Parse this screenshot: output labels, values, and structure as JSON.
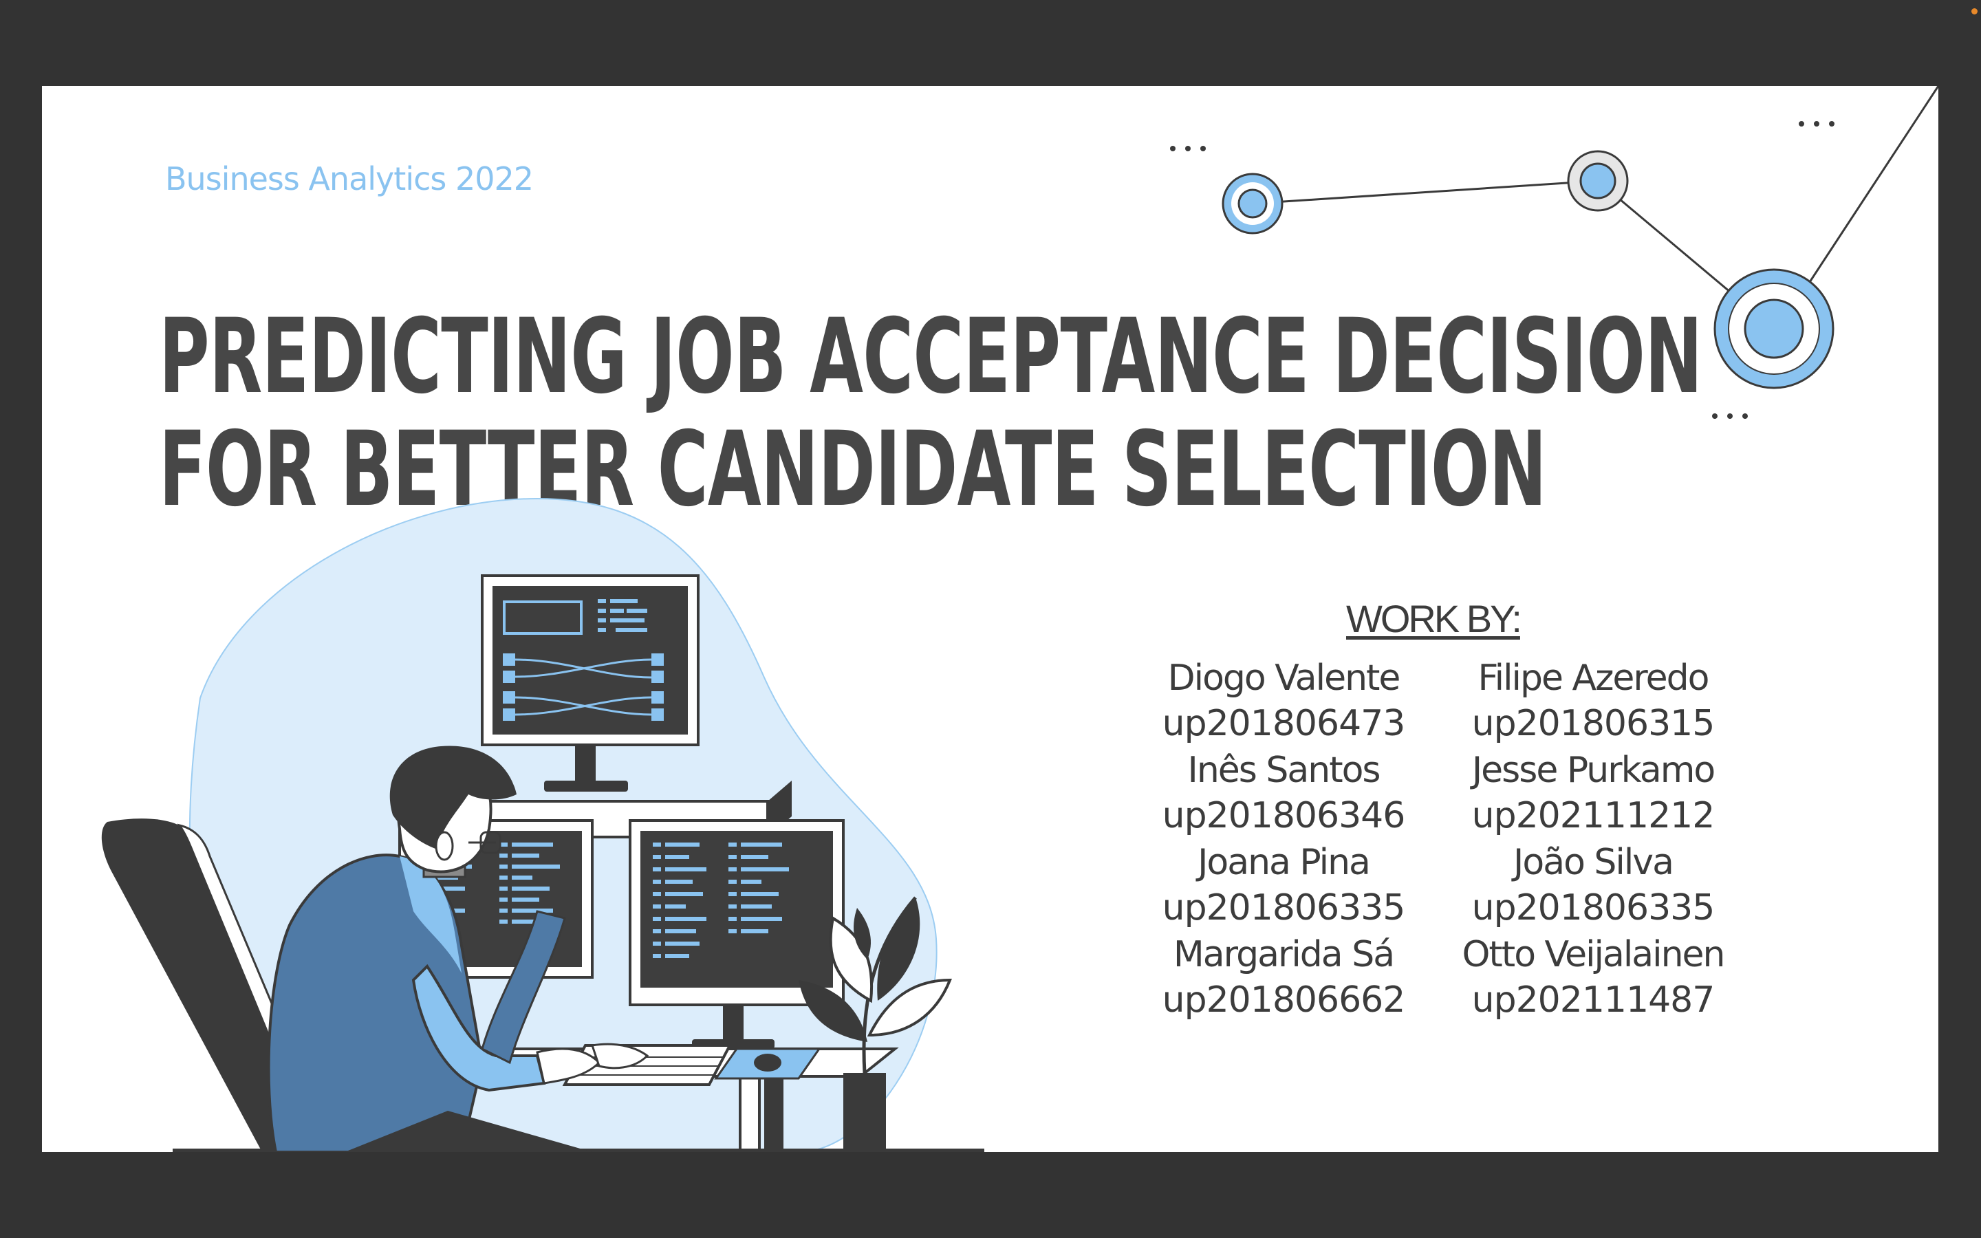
{
  "slide": {
    "subtitle": "Business Analytics 2022",
    "title_line1": "PREDICTING JOB ACCEPTANCE DECISION",
    "title_line2": "FOR BETTER CANDIDATE SELECTION",
    "work_by_label": "WORK BY:"
  },
  "team": [
    {
      "name": "Diogo Valente",
      "id": "up201806473"
    },
    {
      "name": "Filipe Azeredo",
      "id": "up201806315"
    },
    {
      "name": "Inês Santos",
      "id": "up201806346"
    },
    {
      "name": "Jesse Purkamo",
      "id": "up202111212"
    },
    {
      "name": "Joana Pina",
      "id": "up201806335"
    },
    {
      "name": "João Silva",
      "id": "up201806335"
    },
    {
      "name": "Margarida Sá",
      "id": "up201806662"
    },
    {
      "name": "Otto Veijalainen",
      "id": "up202111487"
    }
  ],
  "decorations": {
    "network_graphic": "connected-nodes-icon",
    "ellipsis": "...",
    "illustration": "developer-at-computer-illustration"
  },
  "colors": {
    "background": "#333333",
    "slide": "#ffffff",
    "accent": "#8ac3f0",
    "text": "#474747",
    "shirt": "#4f7aa6"
  }
}
